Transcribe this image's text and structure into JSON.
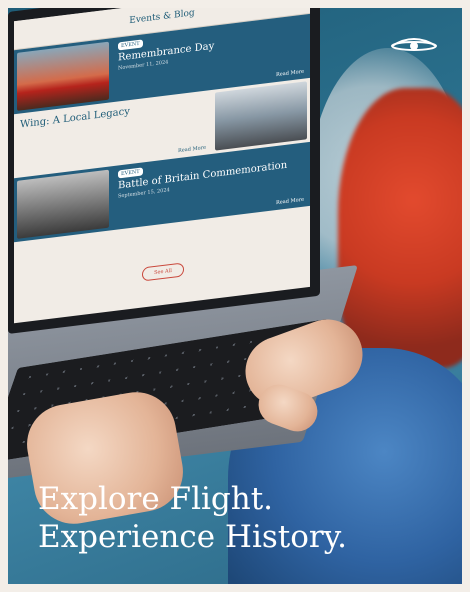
{
  "screen": {
    "section_title": "Events & Blog",
    "events": [
      {
        "tag": "EVENT",
        "title": "Remembrance Day",
        "date": "November 11, 2024",
        "more": "Read More"
      },
      {
        "tag": "",
        "title": "Wing: A Local Legacy",
        "date": "",
        "more": "Read More"
      },
      {
        "tag": "EVENT",
        "title": "Battle of Britain Commemoration",
        "date": "September 15, 2024",
        "more": "Read More"
      }
    ],
    "see_all": "See All"
  },
  "logo": {
    "icon": "propeller-logo-icon"
  },
  "headline": {
    "line1": "Explore Flight.",
    "line2": "Experience History."
  }
}
